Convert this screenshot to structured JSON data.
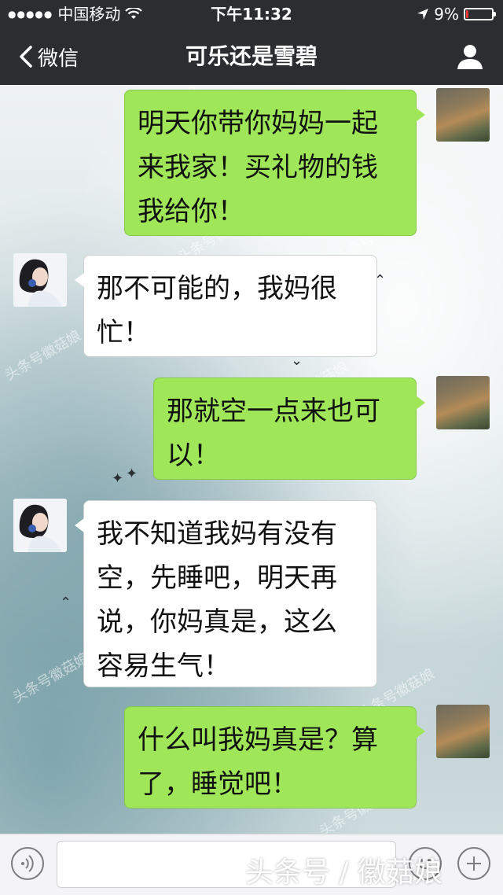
{
  "status_bar": {
    "carrier": "中国移动",
    "time": "下午11:32",
    "battery": "9%",
    "battery_level": 0.09
  },
  "nav": {
    "back_label": "微信",
    "title": "可乐还是雪碧"
  },
  "messages": [
    {
      "sender": "me",
      "lines": [
        "明天你带你妈妈一起",
        "来我家！买礼物的钱",
        "我给你！"
      ]
    },
    {
      "sender": "them",
      "lines": [
        "那不可能的，我妈很",
        "忙！"
      ]
    },
    {
      "sender": "me",
      "lines": [
        "那就空一点来也可",
        "以！"
      ]
    },
    {
      "sender": "them",
      "lines": [
        "我不知道我妈有没有",
        "空，先睡吧，明天再",
        "说，你妈真是，这么",
        "容易生气！"
      ]
    },
    {
      "sender": "me",
      "lines": [
        "什么叫我妈真是？算",
        "了，睡觉吧！"
      ]
    }
  ],
  "watermark": {
    "background_text": "头条号徽菇娘",
    "overlay_text": "头条号 / 徽菇娘"
  },
  "icons": {
    "back": "chevron-left-icon",
    "profile": "person-icon",
    "voice": "voice-icon",
    "emoji": "emoji-icon",
    "plus": "plus-icon",
    "wifi": "wifi-icon",
    "location": "location-arrow-icon",
    "battery": "battery-icon"
  },
  "colors": {
    "my_bubble": "#9fe658",
    "their_bubble": "#ffffff",
    "nav_background": "#2b2d31",
    "battery_low": "#e53935"
  }
}
